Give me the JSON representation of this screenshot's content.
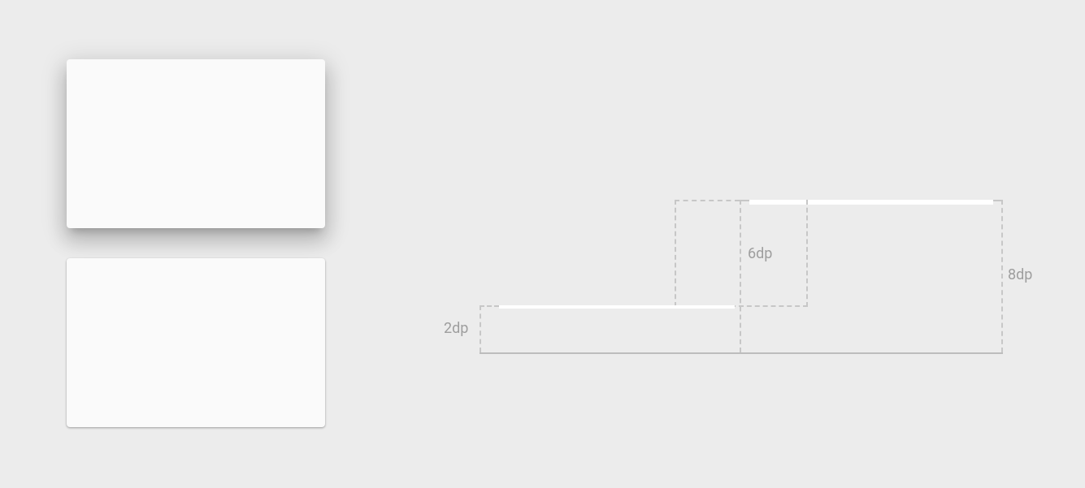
{
  "elevations": {
    "label_2dp": "2dp",
    "label_6dp": "6dp",
    "label_8dp": "8dp"
  }
}
